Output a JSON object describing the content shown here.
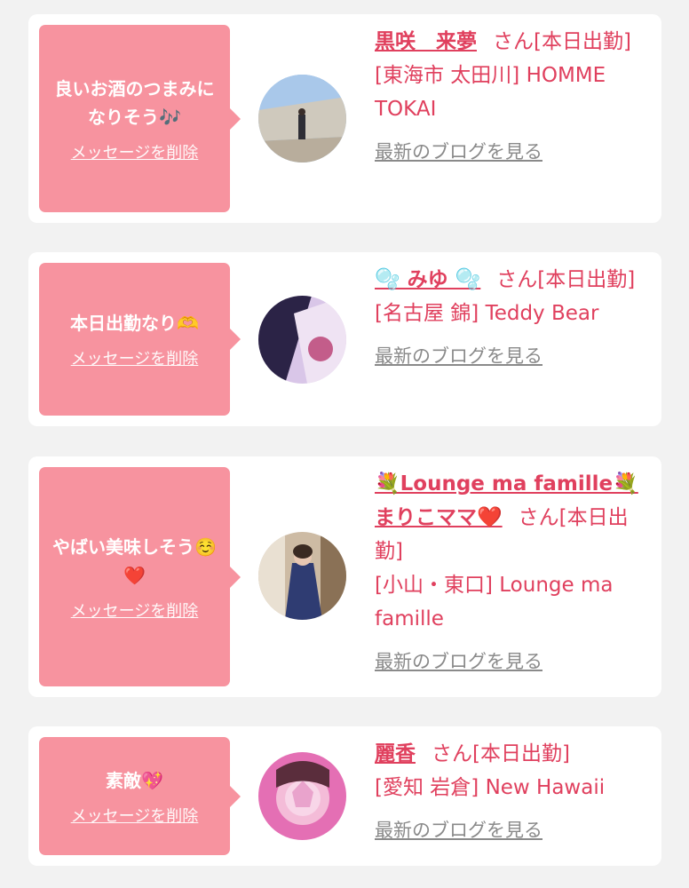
{
  "cards": [
    {
      "message": "良いお酒のつまみになりそう🎶",
      "delete_label": "メッセージを削除",
      "name": "黒咲　来夢",
      "suffix": "さん[本日出勤]",
      "location": "[東海市 太田川] HOMME TOKAI",
      "blog_label": "最新のブログを見る"
    },
    {
      "message": "本日出勤なり🫶",
      "delete_label": "メッセージを削除",
      "name": "🫧 みゆ 🫧",
      "suffix": "さん[本日出勤]",
      "location": "[名古屋 錦] Teddy Bear",
      "blog_label": "最新のブログを見る"
    },
    {
      "message": "やばい美味しそう☺️❤️",
      "delete_label": "メッセージを削除",
      "name": "💐Lounge ma famille💐まりこママ❤️",
      "suffix": "さん[本日出勤]",
      "location": "[小山・東口] Lounge ma famille",
      "blog_label": "最新のブログを見る"
    },
    {
      "message": "素敵💖",
      "delete_label": "メッセージを削除",
      "name": "麗香",
      "suffix": "さん[本日出勤]",
      "location": "[愛知 岩倉] New Hawaii",
      "blog_label": "最新のブログを見る"
    }
  ],
  "colors": {
    "background": "#f2f2f2",
    "card": "#ffffff",
    "bubble": "#f7939f",
    "accent_text": "#e0405e",
    "link_gray": "#8a8a8a"
  }
}
